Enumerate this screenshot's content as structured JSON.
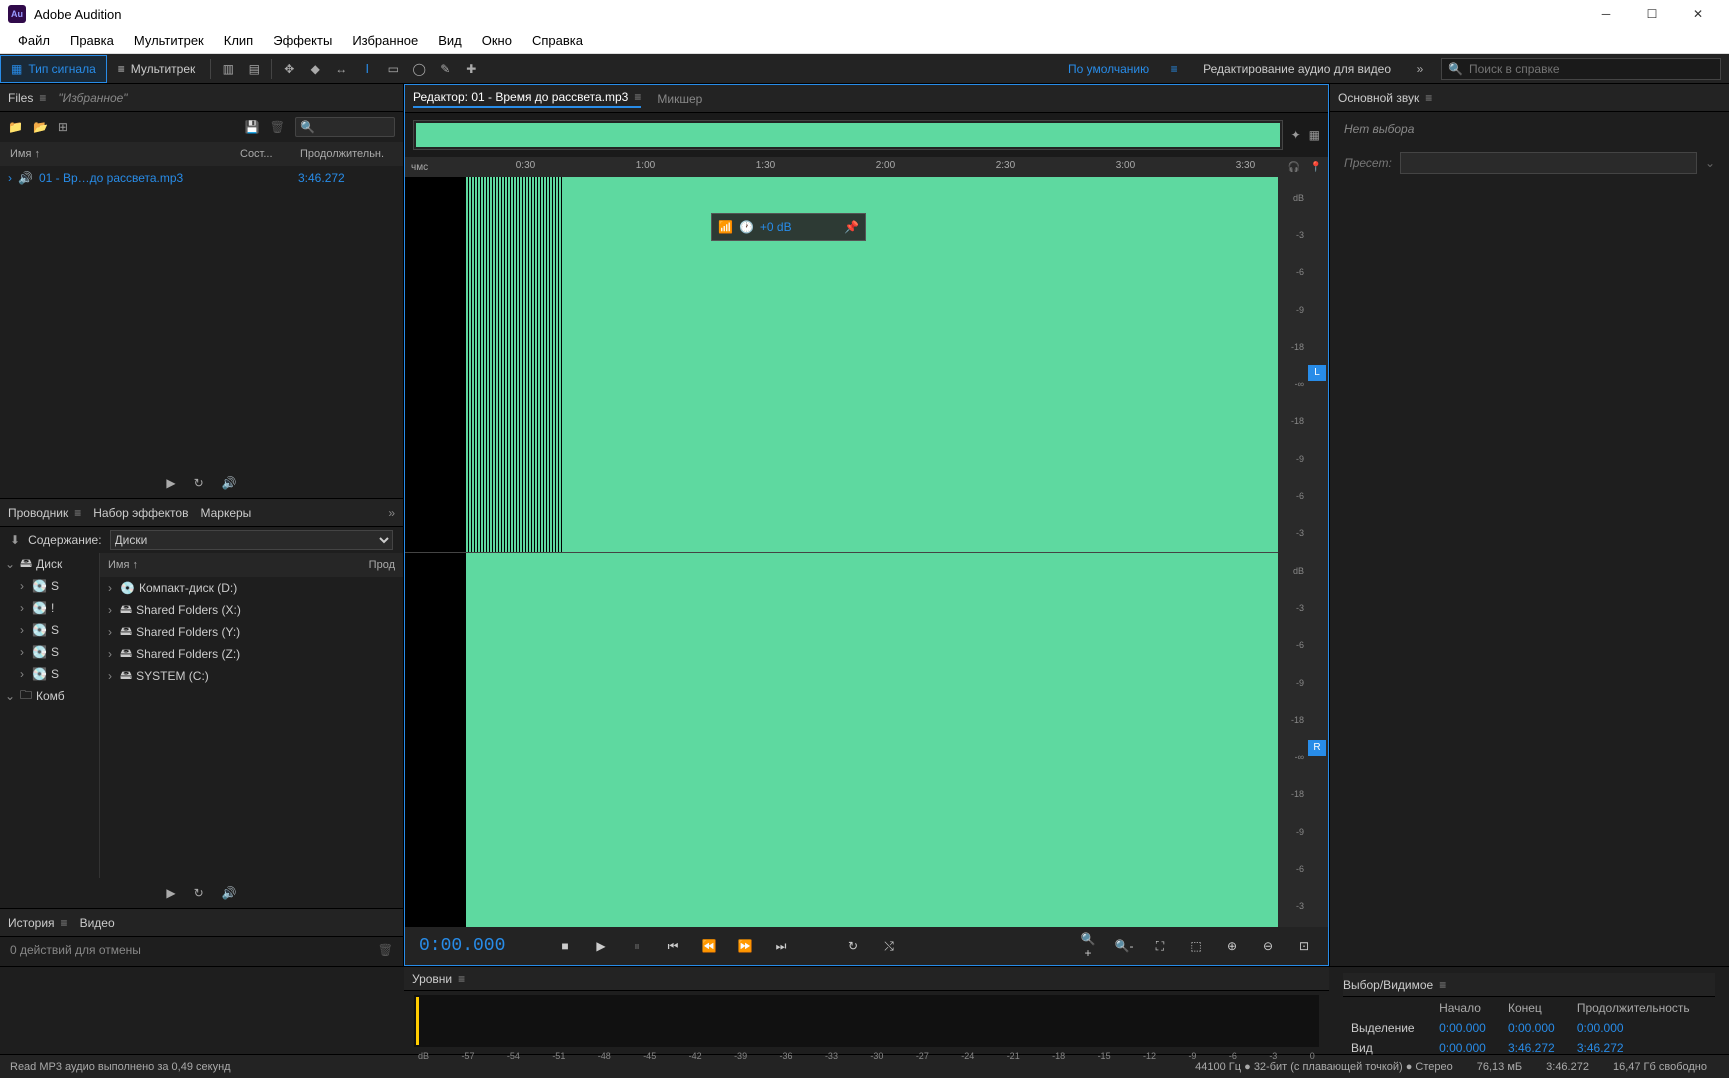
{
  "window": {
    "title": "Adobe Audition",
    "logo": "Au"
  },
  "menu": [
    "Файл",
    "Правка",
    "Мультитрек",
    "Клип",
    "Эффекты",
    "Избранное",
    "Вид",
    "Окно",
    "Справка"
  ],
  "toolbar": {
    "waveform": "Тип сигнала",
    "multitrack": "Мультитрек",
    "workspace_default": "По умолчанию",
    "workspace_video": "Редактирование аудио для видео",
    "search_placeholder": "Поиск в справке"
  },
  "files": {
    "tab": "Files",
    "fav": "\"Избранное\"",
    "cols": {
      "name": "Имя ↑",
      "state": "Сост...",
      "dur": "Продолжительн."
    },
    "row": {
      "name": "01 - Вр…до рассвета.mp3",
      "dur": "3:46.272"
    }
  },
  "explorer": {
    "tab1": "Проводник",
    "tab2": "Набор эффектов",
    "tab3": "Маркеры",
    "content_label": "Содержание:",
    "content_value": "Диски",
    "left_root": "Диск",
    "left_combo": "Комб",
    "name_col": "Имя ↑",
    "dur_col": "Прод",
    "items": [
      "Компакт-диск (D:)",
      "Shared Folders (X:)",
      "Shared Folders (Y:)",
      "Shared Folders (Z:)",
      "SYSTEM (C:)"
    ]
  },
  "history": {
    "tab1": "История",
    "tab2": "Видео",
    "text": "0 действий для отмены"
  },
  "editor": {
    "tab": "Редактор: 01 - Время до рассвета.mp3",
    "mixer": "Микшер",
    "ruler_unit": "чмс",
    "ticks": [
      "0:30",
      "1:00",
      "1:30",
      "2:00",
      "2:30",
      "3:00",
      "3:30"
    ],
    "db_marks": [
      "dB",
      "-3",
      "-6",
      "-9",
      "-18",
      "-∞",
      "-18",
      "-9",
      "-6",
      "-3",
      "dB",
      "-3",
      "-6",
      "-9",
      "-18",
      "-∞",
      "-18",
      "-9",
      "-6",
      "-3"
    ],
    "hud": "+0 dB",
    "chL": "L",
    "chR": "R",
    "time": "0:00.000"
  },
  "right": {
    "tab": "Основной звук",
    "empty": "Нет выбора",
    "preset": "Пресет:"
  },
  "levels": {
    "tab": "Уровни",
    "marks": [
      "dB",
      "-57",
      "-54",
      "-51",
      "-48",
      "-45",
      "-42",
      "-39",
      "-36",
      "-33",
      "-30",
      "-27",
      "-24",
      "-21",
      "-18",
      "-15",
      "-12",
      "-9",
      "-6",
      "-3",
      "0"
    ]
  },
  "selview": {
    "tab": "Выбор/Видимое",
    "h_start": "Начало",
    "h_end": "Конец",
    "h_dur": "Продолжительность",
    "r_sel": "Выделение",
    "r_view": "Вид",
    "sel_start": "0:00.000",
    "sel_end": "0:00.000",
    "sel_dur": "0:00.000",
    "view_start": "0:00.000",
    "view_end": "3:46.272",
    "view_dur": "3:46.272"
  },
  "status": {
    "msg": "Read MP3 аудио выполнено за 0,49 секунд",
    "fmt": "44100 Гц ● 32-бит (с плавающей точкой) ● Стерео",
    "size": "76,13 мБ",
    "dur": "3:46.272",
    "free": "16,47 Гб свободно"
  }
}
